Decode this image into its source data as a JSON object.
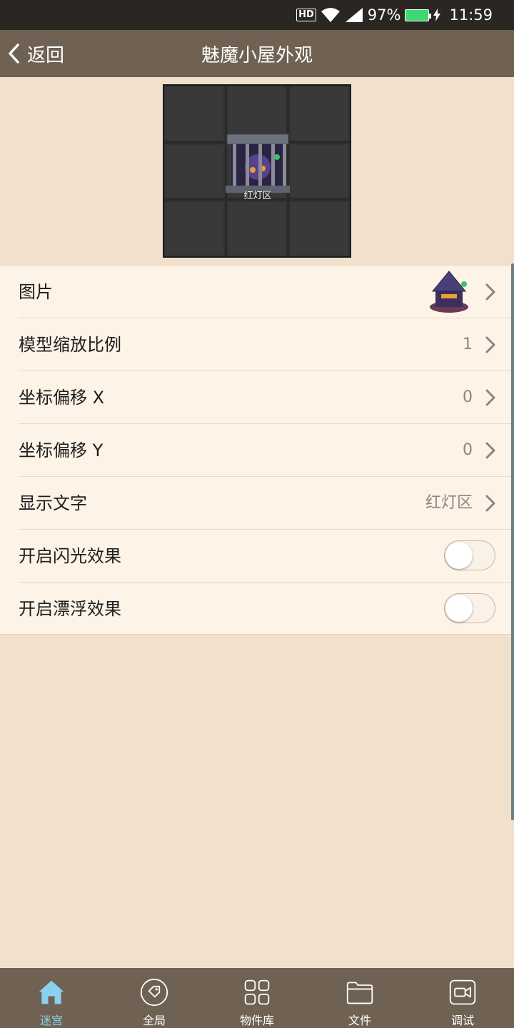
{
  "status_bar": {
    "hd": "HD",
    "battery": "97%",
    "time": "11:59"
  },
  "app_bar": {
    "back_label": "返回",
    "title": "魅魔小屋外观"
  },
  "preview": {
    "label": "红灯区"
  },
  "settings": [
    {
      "label": "图片",
      "value": "",
      "type": "image"
    },
    {
      "label": "模型缩放比例",
      "value": "1",
      "type": "value"
    },
    {
      "label": "坐标偏移 X",
      "value": "0",
      "type": "value"
    },
    {
      "label": "坐标偏移 Y",
      "value": "0",
      "type": "value"
    },
    {
      "label": "显示文字",
      "value": "红灯区",
      "type": "value"
    },
    {
      "label": "开启闪光效果",
      "on": false,
      "type": "toggle"
    },
    {
      "label": "开启漂浮效果",
      "on": false,
      "type": "toggle"
    }
  ],
  "bottom_nav": [
    {
      "label": "迷宫",
      "icon": "home-icon",
      "active": true
    },
    {
      "label": "全局",
      "icon": "tag-icon",
      "active": false
    },
    {
      "label": "物件库",
      "icon": "grid-icon",
      "active": false
    },
    {
      "label": "文件",
      "icon": "folder-icon",
      "active": false
    },
    {
      "label": "调试",
      "icon": "video-icon",
      "active": false
    }
  ],
  "colors": {
    "bar": "#6f6253",
    "background": "#f1e1cc",
    "list": "#fdf3e6",
    "active_nav": "#8ad0ef"
  }
}
